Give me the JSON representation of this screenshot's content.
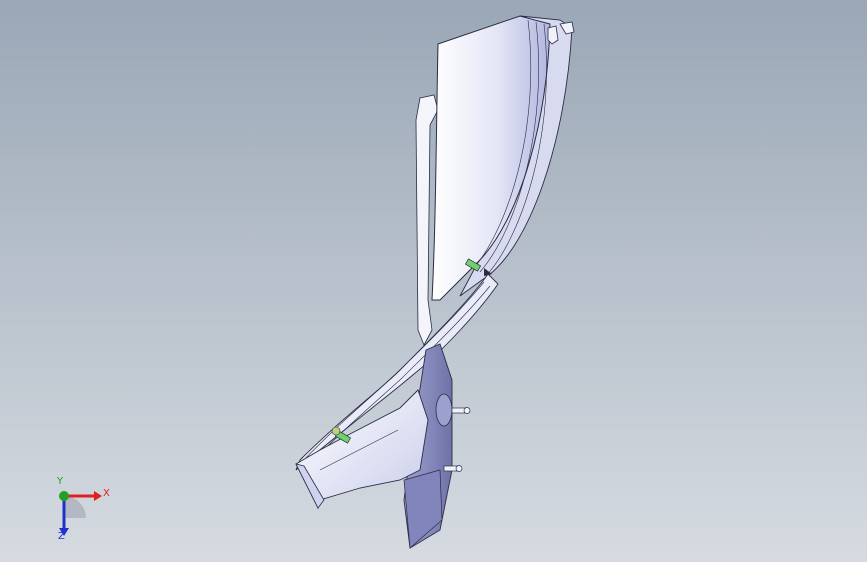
{
  "viewport": {
    "background_top": "#9aa7b6",
    "background_bottom": "#d6dbe1"
  },
  "model": {
    "part_face_color": "#e6e8f6",
    "part_shade_color": "#b9bde0",
    "part_edge_color": "#2a2c45",
    "clip_color": "#6fd36a"
  },
  "triad": {
    "x_label": "X",
    "y_label": "Y",
    "z_label": "Z",
    "x_color": "#e02020",
    "y_color": "#22a022",
    "z_color": "#2030d0"
  }
}
